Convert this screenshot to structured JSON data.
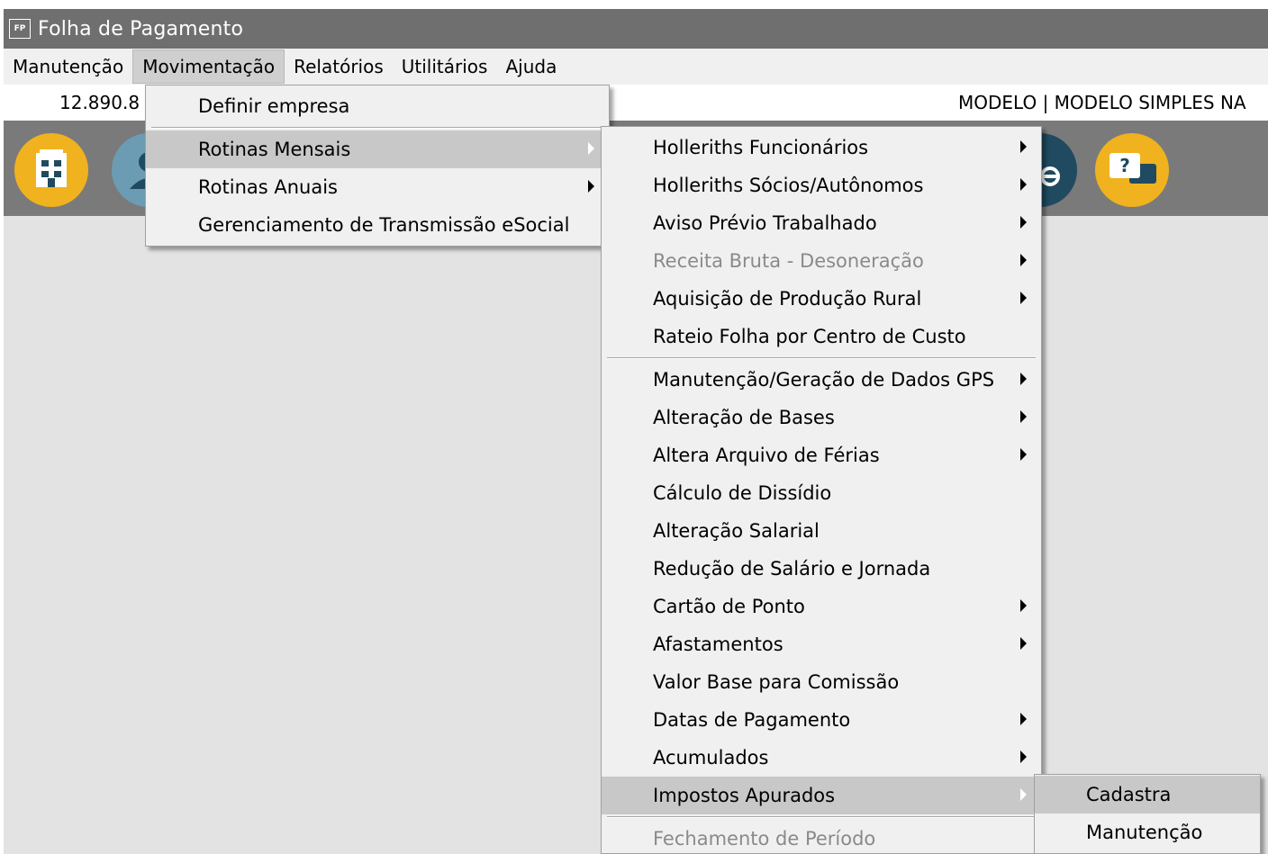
{
  "window": {
    "icon_label": "FP",
    "title": "Folha de Pagamento"
  },
  "menubar": [
    "Manutenção",
    "Movimentação",
    "Relatórios",
    "Utilitários",
    "Ajuda"
  ],
  "info": {
    "left": "12.890.8",
    "right": "MODELO | MODELO SIMPLES NA"
  },
  "toolbar_icons": [
    "building-icon",
    "user-icon",
    "settings-icon",
    "help-chat-icon"
  ],
  "menu_movimentacao": [
    {
      "label": "Definir empresa"
    },
    {
      "label": "Rotinas Mensais",
      "submenu": true,
      "highlighted": true
    },
    {
      "label": "Rotinas Anuais",
      "submenu": true
    },
    {
      "label": "Gerenciamento de Transmissão eSocial"
    }
  ],
  "menu_rotinas_mensais": [
    {
      "label": "Holleriths Funcionários",
      "submenu": true
    },
    {
      "label": "Holleriths Sócios/Autônomos",
      "submenu": true
    },
    {
      "label": "Aviso Prévio Trabalhado",
      "submenu": true
    },
    {
      "label": "Receita Bruta - Desoneração",
      "submenu": true,
      "disabled": true
    },
    {
      "label": "Aquisição de Produção Rural",
      "submenu": true
    },
    {
      "label": "Rateio Folha por Centro de Custo"
    },
    {
      "label": "Manutenção/Geração de Dados GPS",
      "submenu": true
    },
    {
      "label": "Alteração de Bases",
      "submenu": true
    },
    {
      "label": "Altera Arquivo de Férias",
      "submenu": true
    },
    {
      "label": "Cálculo de Dissídio"
    },
    {
      "label": "Alteração Salarial"
    },
    {
      "label": "Redução de Salário e Jornada"
    },
    {
      "label": "Cartão de Ponto",
      "submenu": true
    },
    {
      "label": "Afastamentos",
      "submenu": true
    },
    {
      "label": "Valor Base para Comissão"
    },
    {
      "label": "Datas de Pagamento",
      "submenu": true
    },
    {
      "label": "Acumulados",
      "submenu": true
    },
    {
      "label": "Impostos Apurados",
      "submenu": true,
      "highlighted": true
    },
    {
      "label": "Fechamento de Período",
      "disabled": true
    }
  ],
  "menu_impostos_apurados": [
    {
      "label": "Cadastra",
      "highlighted": true
    },
    {
      "label": "Manutenção"
    }
  ]
}
